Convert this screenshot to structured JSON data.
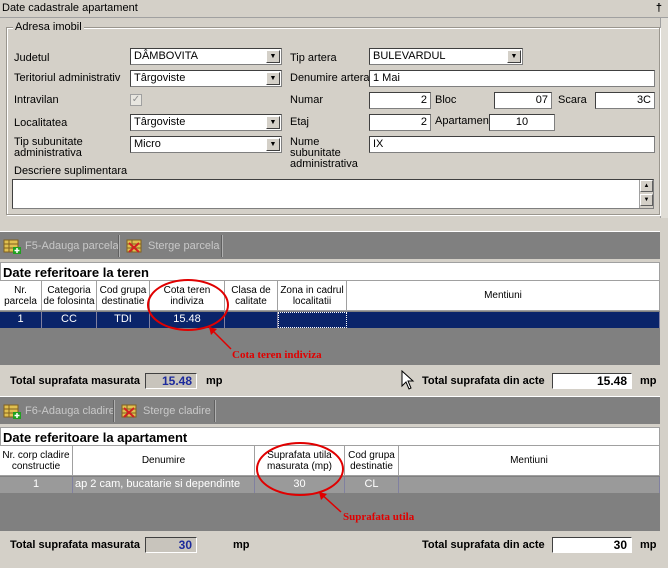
{
  "window": {
    "title": "Date cadastrale apartament",
    "pin_glyph": "†"
  },
  "address": {
    "legend": "Adresa imobil",
    "judetul_label": "Judetul",
    "judetul_value": "DÂMBOVITA",
    "teritoriul_label": "Teritoriul administrativ",
    "teritoriul_value": "Târgoviste",
    "intravilan_label": "Intravilan",
    "intravilan_checked": "✓",
    "localitatea_label": "Localitatea",
    "localitatea_value": "Târgoviste",
    "tip_subunitate_label": "Tip subunitate administrativa",
    "tip_subunitate_value": "Micro",
    "descriere_label": "Descriere suplimentara",
    "descriere_value": "",
    "tip_artera_label": "Tip artera",
    "tip_artera_value": "BULEVARDUL",
    "denumire_artera_label": "Denumire artera",
    "denumire_artera_value": "1 Mai",
    "numar_label": "Numar",
    "numar_value": "2",
    "bloc_label": "Bloc",
    "bloc_value": "07",
    "scara_label": "Scara",
    "scara_value": "3C",
    "etaj_label": "Etaj",
    "etaj_value": "2",
    "apartament_label": "Apartament",
    "apartament_value": "10",
    "nume_subunitate_label": "Nume subunitate administrativa",
    "nume_subunitate_value": "IX"
  },
  "teren": {
    "add_button": "F5-Adauga parcela",
    "delete_button": "Sterge parcela",
    "title": "Date referitoare la teren",
    "columns": [
      "Nr. parcela",
      "Categoria de folosinta",
      "Cod grupa destinatie",
      "Cota teren indiviza",
      "Clasa de calitate",
      "Zona in cadrul localitatii",
      "Mentiuni"
    ],
    "rows": [
      {
        "nr": "1",
        "categoria": "CC",
        "cod": "TDI",
        "cota": "15.48",
        "clasa": "",
        "zona": "",
        "mentiuni": ""
      }
    ],
    "annotation": "Cota  teren indiviza",
    "total_masurata_label": "Total suprafata masurata",
    "total_masurata_value": "15.48",
    "unit": "mp",
    "total_acte_label": "Total suprafata din acte",
    "total_acte_value": "15.48"
  },
  "apartament": {
    "add_button": "F6-Adauga cladire",
    "delete_button": "Sterge cladire",
    "title": "Date referitoare la apartament",
    "columns": [
      "Nr. corp cladire constructie",
      "Denumire",
      "Suprafata utila masurata (mp)",
      "Cod grupa destinatie",
      "Mentiuni"
    ],
    "rows": [
      {
        "nr": "1",
        "denumire": "ap 2 cam, bucatarie si dependinte",
        "suprafata": "30",
        "cod": "CL",
        "mentiuni": ""
      }
    ],
    "annotation": "Suprafata utila",
    "total_masurata_label": "Total suprafata masurata",
    "total_masurata_value": "30",
    "unit": "mp",
    "total_acte_label": "Total suprafata din acte",
    "total_acte_value": "30"
  },
  "colors": {
    "annotation": "#e00000",
    "selected_row": "#0a246a",
    "total_value": "#1c2a9c"
  }
}
